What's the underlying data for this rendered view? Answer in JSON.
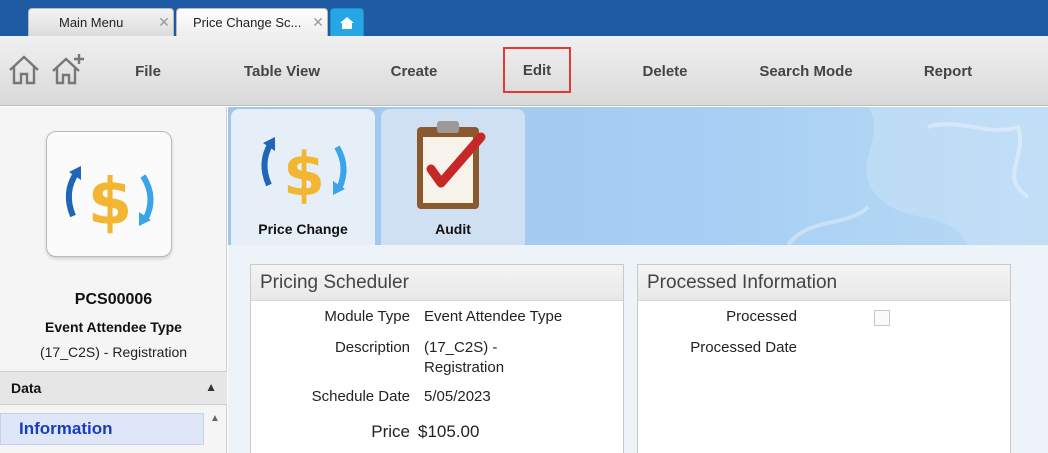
{
  "tabs": [
    {
      "label": "Main Menu"
    },
    {
      "label": "Price Change Sc..."
    }
  ],
  "toolbar": {
    "items": [
      {
        "label": "File"
      },
      {
        "label": "Table View"
      },
      {
        "label": "Create"
      },
      {
        "label": "Edit"
      },
      {
        "label": "Delete"
      },
      {
        "label": "Search Mode"
      },
      {
        "label": "Report"
      }
    ],
    "highlight_color": "#e53935"
  },
  "record": {
    "code": "PCS00006",
    "type": "Event Attendee Type",
    "subtitle": "(17_C2S) - Registration"
  },
  "sidebar": {
    "section_title": "Data",
    "items": [
      {
        "label": "Information"
      }
    ]
  },
  "modules": [
    {
      "label": "Price Change",
      "icon": "dollar-sync-icon"
    },
    {
      "label": "Audit",
      "icon": "clipboard-check-icon"
    }
  ],
  "pricing": {
    "title": "Pricing Scheduler",
    "module_type_label": "Module Type",
    "module_type_value": "Event Attendee Type",
    "description_label": "Description",
    "description_line1": "(17_C2S) -",
    "description_line2": "Registration",
    "schedule_date_label": "Schedule Date",
    "schedule_date_value": "5/05/2023",
    "price_label": "Price",
    "price_value": "$105.00"
  },
  "processed": {
    "title": "Processed Information",
    "processed_label": "Processed",
    "processed_checked": false,
    "processed_date_label": "Processed Date",
    "processed_date_value": ""
  },
  "colors": {
    "tabstrip": "#1f5ba3",
    "nav_active_text": "#1a3dbf",
    "dollar": "#f2b632",
    "arrow_dark": "#1f66b8",
    "arrow_light": "#3aa4e8"
  }
}
